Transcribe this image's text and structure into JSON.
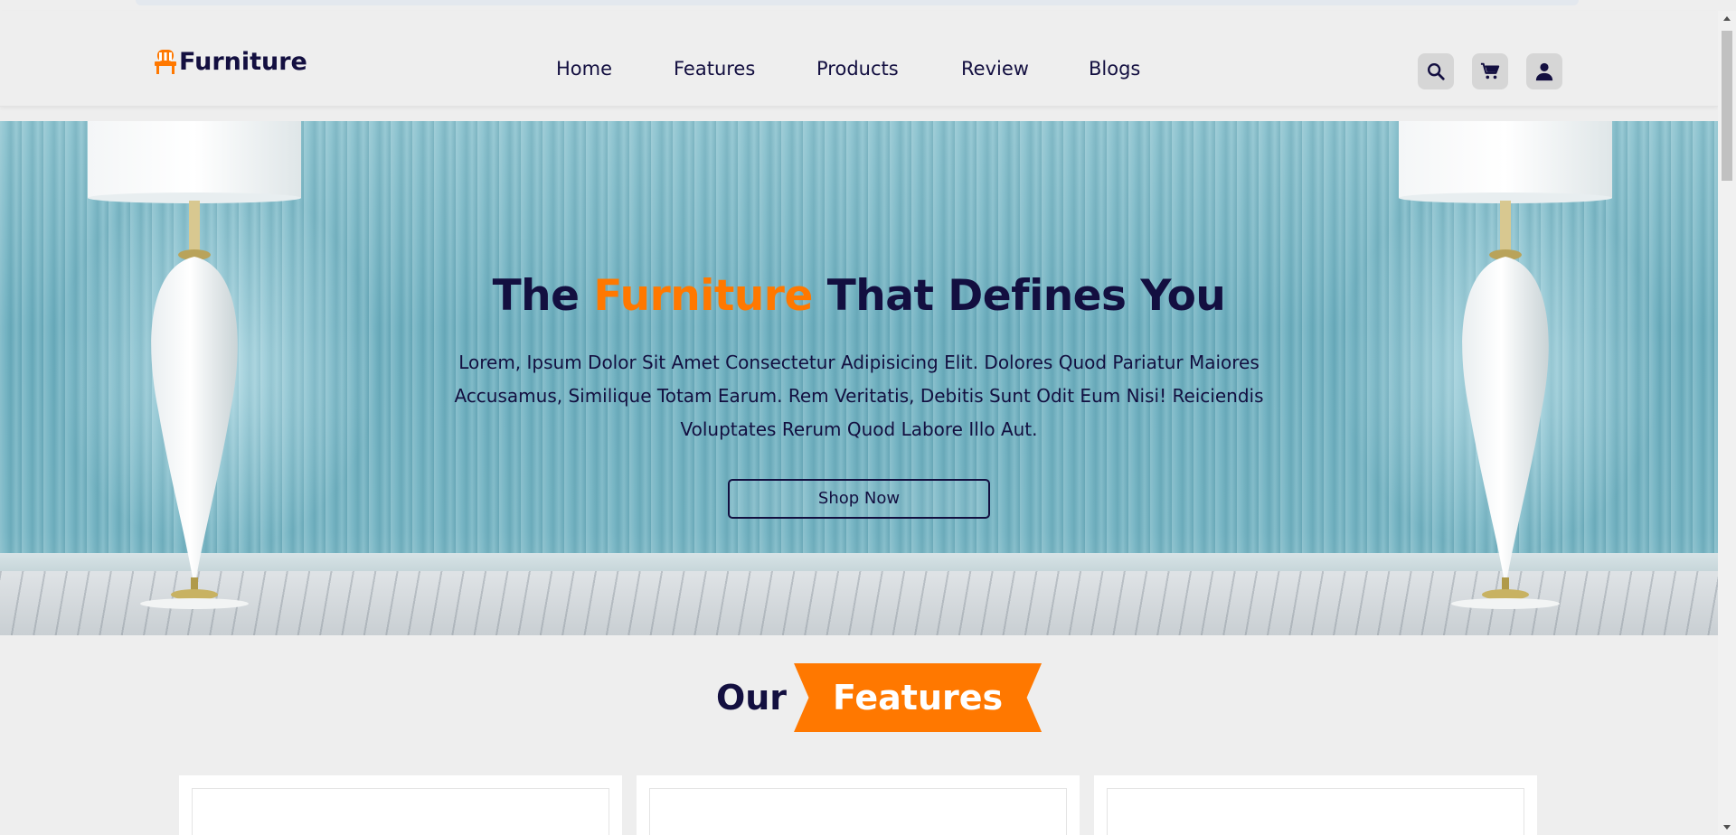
{
  "header": {
    "logo_text": "Furniture",
    "nav": [
      {
        "label": "Home"
      },
      {
        "label": "Features"
      },
      {
        "label": "Products"
      },
      {
        "label": "Review"
      },
      {
        "label": "Blogs"
      }
    ],
    "icons": [
      "search-icon",
      "cart-icon",
      "user-icon"
    ]
  },
  "hero": {
    "title_before": "The ",
    "title_accent": "Furniture",
    "title_after": " That Defines You",
    "text": "Lorem, Ipsum Dolor Sit Amet Consectetur Adipisicing Elit. Dolores Quod Pariatur Maiores Accusamus, Similique Totam Earum. Rem Veritatis, Debitis Sunt Odit Eum Nisi! Reiciendis Voluptates Rerum Quod Labore Illo Aut.",
    "button_label": "Shop Now"
  },
  "features": {
    "heading_plain": "Our",
    "heading_ribbon": "Features"
  },
  "colors": {
    "primary": "#130f40",
    "accent": "#ff7800",
    "background": "#eeeeee"
  }
}
